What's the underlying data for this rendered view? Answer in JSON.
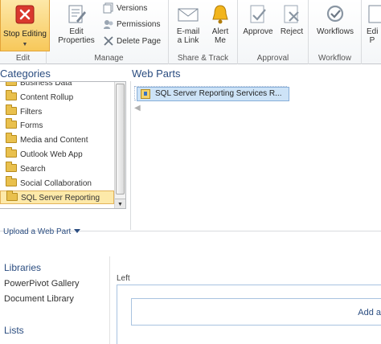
{
  "ribbon": {
    "edit_group": {
      "stop_editing": "Stop Editing",
      "label": "Edit"
    },
    "manage_group": {
      "edit_properties": "Edit Properties",
      "versions": "Versions",
      "permissions": "Permissions",
      "delete_page": "Delete Page",
      "label": "Manage"
    },
    "share_group": {
      "email_link": "E-mail a Link",
      "alert_me": "Alert Me",
      "label": "Share & Track"
    },
    "approval_group": {
      "approve": "Approve",
      "reject": "Reject",
      "label": "Approval"
    },
    "workflow_group": {
      "workflows": "Workflows",
      "label": "Workflow"
    },
    "cut_off_button": "Edi P"
  },
  "gallery": {
    "categories_title": "Categories",
    "categories": [
      {
        "label": "Business Data",
        "selected": false
      },
      {
        "label": "Content Rollup",
        "selected": false
      },
      {
        "label": "Filters",
        "selected": false
      },
      {
        "label": "Forms",
        "selected": false
      },
      {
        "label": "Media and Content",
        "selected": false
      },
      {
        "label": "Outlook Web App",
        "selected": false
      },
      {
        "label": "Search",
        "selected": false
      },
      {
        "label": "Social Collaboration",
        "selected": false
      },
      {
        "label": "SQL Server Reporting",
        "selected": true
      }
    ],
    "upload_link": "Upload a Web Part",
    "webparts_title": "Web Parts",
    "webparts": [
      {
        "label": "SQL Server Reporting Services R..."
      }
    ]
  },
  "quicklaunch": {
    "libraries_heading": "Libraries",
    "links": [
      "PowerPivot Gallery",
      "Document Library"
    ],
    "lists_heading": "Lists"
  },
  "content": {
    "zone_label": "Left",
    "add_webpart": "Add a"
  },
  "colors": {
    "accent": "#2b4d80",
    "stop_editing_bg": "#f7c85a",
    "selected_category": "#fde9a9",
    "selected_webpart": "#cde3f7"
  }
}
